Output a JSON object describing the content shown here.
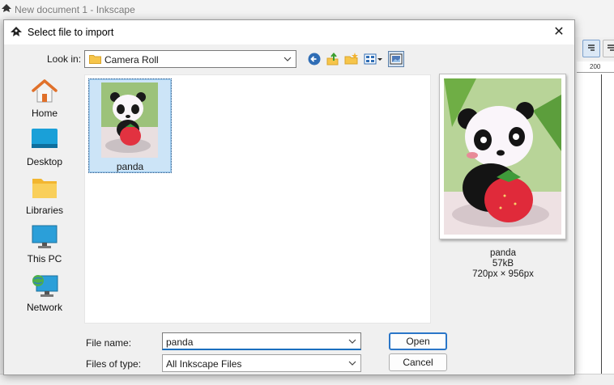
{
  "background_window": {
    "title": "New document 1 - Inkscape",
    "ruler_number": "200"
  },
  "dialog": {
    "title": "Select file to import",
    "close_glyph": "✕",
    "look_in_label": "Look in:",
    "look_in_value": "Camera Roll",
    "toolbar_icons": [
      "back-icon",
      "up-folder-icon",
      "new-folder-icon",
      "view-menu-icon",
      "preview-toggle-icon"
    ]
  },
  "places": [
    {
      "label": "Home",
      "icon": "home-icon"
    },
    {
      "label": "Desktop",
      "icon": "desktop-icon"
    },
    {
      "label": "Libraries",
      "icon": "libraries-icon"
    },
    {
      "label": "This PC",
      "icon": "this-pc-icon"
    },
    {
      "label": "Network",
      "icon": "network-icon"
    }
  ],
  "files": [
    {
      "name": "panda"
    }
  ],
  "preview": {
    "name": "panda",
    "size": "57kB",
    "dimensions": "720px × 956px"
  },
  "form": {
    "file_name_label": "File name:",
    "file_name_value": "panda",
    "file_type_label": "Files of type:",
    "file_type_value": "All Inkscape Files",
    "open_label": "Open",
    "cancel_label": "Cancel"
  },
  "colors": {
    "selection": "#cce4f7",
    "accent": "#1a6fbf"
  }
}
